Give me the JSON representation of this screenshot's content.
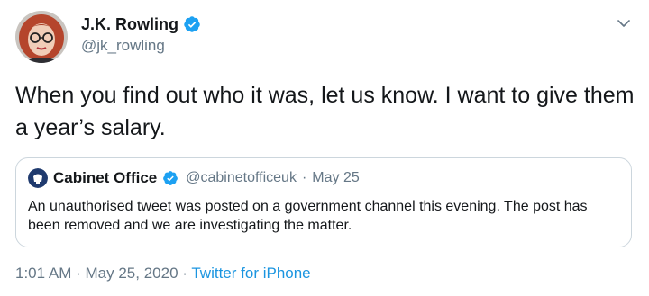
{
  "author": {
    "display_name": "J.K. Rowling",
    "handle": "@jk_rowling",
    "verified": true
  },
  "tweet": {
    "text": "When you find out who it was, let us know. I want to give them a year’s salary."
  },
  "quoted_tweet": {
    "display_name": "Cabinet Office",
    "handle": "@cabinetofficeuk",
    "separator": "·",
    "date": "May 25",
    "verified": true,
    "text": "An unauthorised tweet was posted on a government channel this evening. The post has been removed and we are investigating the matter."
  },
  "meta": {
    "time": "1:01 AM",
    "separator1": "·",
    "date": "May 25, 2020",
    "separator2": "·",
    "source": "Twitter for iPhone"
  },
  "icons": {
    "verified": "verified-badge-icon",
    "more": "chevron-down-icon"
  },
  "colors": {
    "verified_blue": "#1da1f2",
    "link_blue": "#1b95e0",
    "secondary_text": "#657786",
    "border": "#ccd6dd"
  }
}
